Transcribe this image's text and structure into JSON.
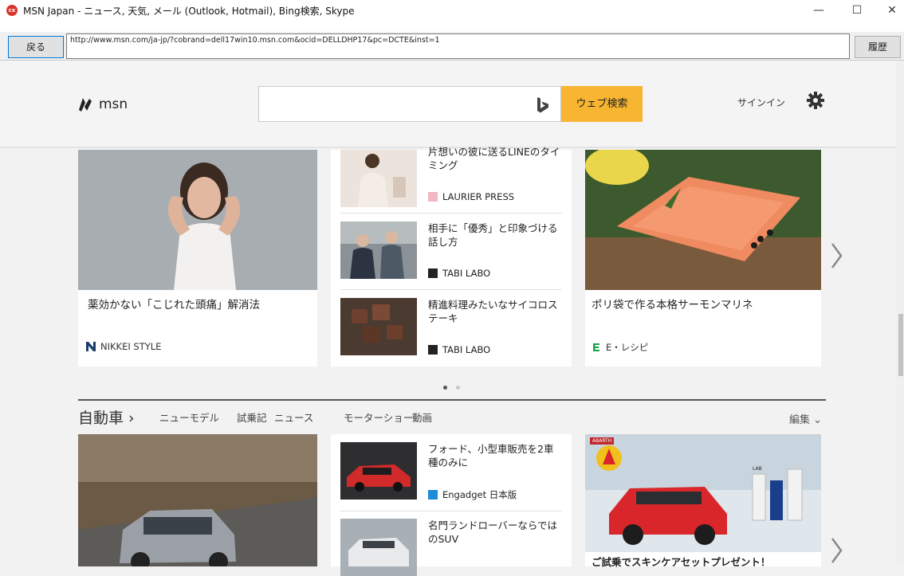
{
  "window": {
    "app_icon_text": "cx",
    "title": "MSN Japan - ニュース, 天気, メール (Outlook, Hotmail), Bing検索, Skype",
    "minimize": "—",
    "maximize": "☐",
    "close": "✕"
  },
  "nav": {
    "back_label": "戻る",
    "url": "http://www.msn.com/ja-jp/?cobrand=dell17win10.msn.com&ocid=DELLDHP17&pc=DCTE&inst=1",
    "history_label": "履歴"
  },
  "header": {
    "logo_text": "msn",
    "search_placeholder": "",
    "search_button": "ウェブ検索",
    "signin": "サインイン"
  },
  "carousel1": {
    "feature_left": {
      "headline": "薬効かない「こじれた頭痛」解消法",
      "source": "NIKKEI STYLE"
    },
    "middle_items": [
      {
        "title": "片想いの彼に送るLINEのタイミング",
        "source": "LAURIER PRESS"
      },
      {
        "title": "相手に「優秀」と印象づける話し方",
        "source": "TABI LABO"
      },
      {
        "title": "精進料理みたいなサイコロステーキ",
        "source": "TABI LABO"
      }
    ],
    "feature_right": {
      "headline": "ポリ袋で作る本格サーモンマリネ",
      "source": "E・レシピ"
    }
  },
  "section": {
    "title": "自動車 ›",
    "nav": [
      "ニューモデル",
      "試乗記",
      "ニュース",
      "モーターショー",
      "動画"
    ],
    "edit": "編集 ⌄"
  },
  "carousel2": {
    "middle_items": [
      {
        "title": "フォード、小型車販売を2車種のみに",
        "source": "Engadget 日本版"
      },
      {
        "title": "名門ランドローバーならではのSUV",
        "source": ""
      }
    ],
    "ad": {
      "brand_badge": "ABARTH",
      "product_badge": "LAB",
      "headline": "ご試乗でスキンケアセットプレゼント！"
    }
  },
  "colors": {
    "accent": "#f7b531",
    "window_bg": "#f2f2f2",
    "card_bg": "#ffffff"
  }
}
